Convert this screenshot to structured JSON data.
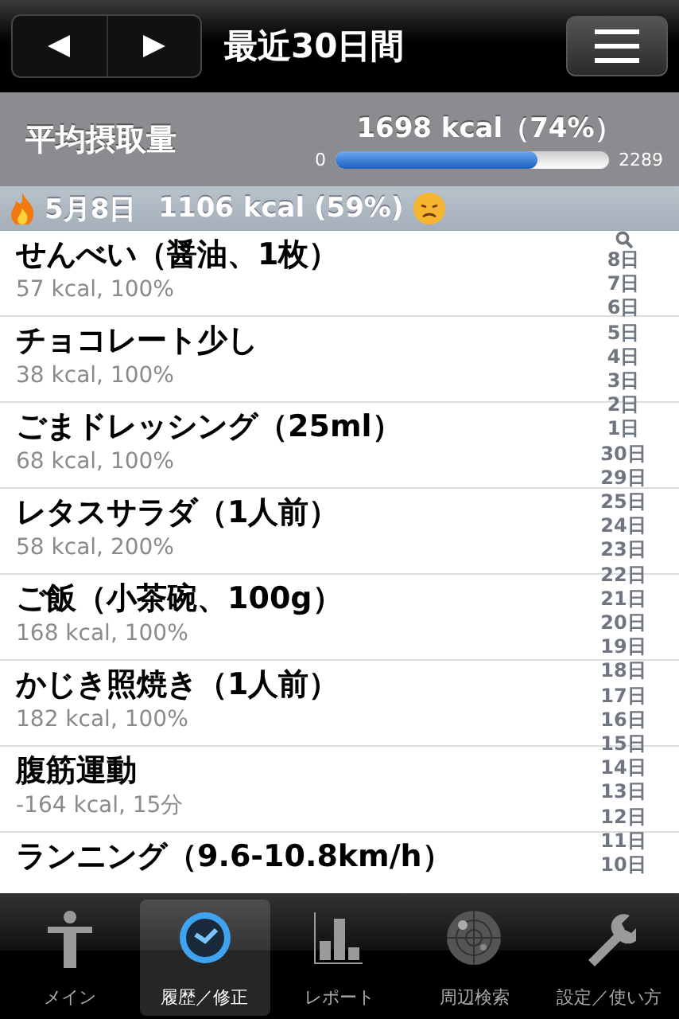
{
  "nav": {
    "title": "最近30日間"
  },
  "summary": {
    "label": "平均摂取量",
    "value": "1698 kcal（74%）",
    "min": "0",
    "max": "2289",
    "level": 0.74
  },
  "day": {
    "date": "5月8日",
    "total": "1106 kcal (59%)"
  },
  "entries": [
    {
      "name": "せんべい（醤油、1枚）",
      "detail": "57 kcal, 100%"
    },
    {
      "name": "チョコレート少し",
      "detail": "38 kcal, 100%"
    },
    {
      "name": "ごまドレッシング（25ml）",
      "detail": "68 kcal, 100%"
    },
    {
      "name": "レタスサラダ（1人前）",
      "detail": "58 kcal, 200%"
    },
    {
      "name": "ご飯（小茶碗、100g）",
      "detail": "168 kcal, 100%"
    },
    {
      "name": "かじき照焼き（1人前）",
      "detail": "182 kcal, 100%"
    },
    {
      "name": "腹筋運動",
      "detail": "-164 kcal, 15分"
    },
    {
      "name": "ランニング（9.6-10.8km/h）"
    }
  ],
  "index": [
    "8日",
    "7日",
    "6日",
    "5日",
    "4日",
    "3日",
    "2日",
    "1日",
    "30日",
    "29日",
    "25日",
    "24日",
    "23日",
    "22日",
    "21日",
    "20日",
    "19日",
    "18日",
    "17日",
    "16日",
    "15日",
    "14日",
    "13日",
    "12日",
    "11日",
    "10日"
  ],
  "tabs": [
    {
      "kind": "person",
      "label": "メイン",
      "selected": false
    },
    {
      "kind": "clock",
      "label": "履歴／修正",
      "selected": true
    },
    {
      "kind": "chart",
      "label": "レポート",
      "selected": false
    },
    {
      "kind": "radar",
      "label": "周辺検索",
      "selected": false
    },
    {
      "kind": "wrench",
      "label": "設定／使い方",
      "selected": false
    }
  ]
}
